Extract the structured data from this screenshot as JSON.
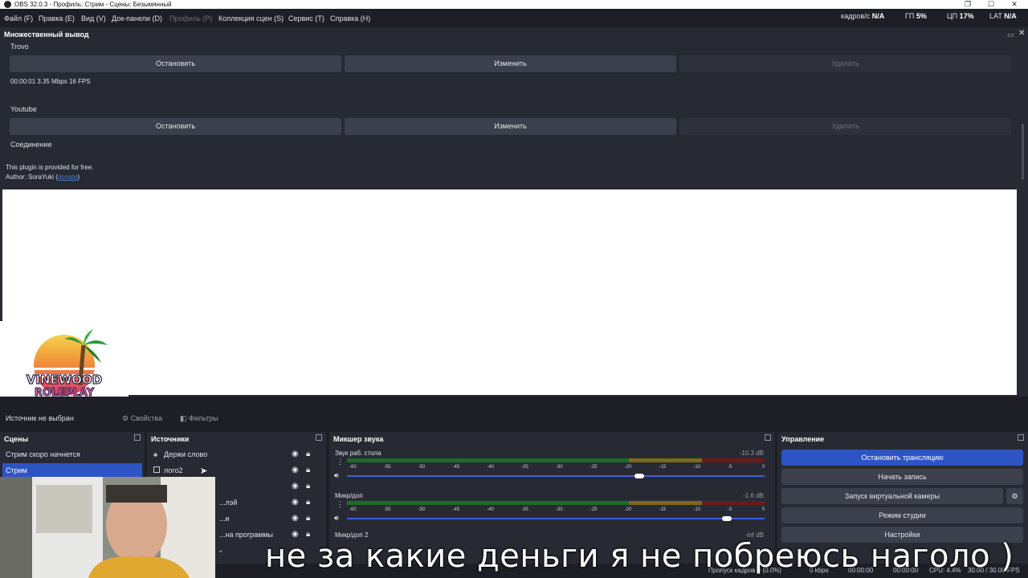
{
  "titlebar": {
    "title": "OBS 32.0.3 - Профиль: Стрим - Сцены: Безымянный"
  },
  "menu": {
    "items": [
      "Файл (F)",
      "Правка (E)",
      "Вид (V)",
      "Док-панели (D)",
      "Профиль (P)",
      "Коллекция сцен (S)",
      "Сервис (T)",
      "Справка (H)"
    ],
    "stats": {
      "fps_label": "кадров/с",
      "fps_value": "N/A",
      "gpu_label": "ГП",
      "gpu_value": "5%",
      "cpu_label": "ЦП",
      "cpu_value": "17%",
      "lat_label": "LAT",
      "lat_value": "N/A"
    }
  },
  "multi_output": {
    "title": "Множественный вывод",
    "targets": [
      {
        "name": "Trovo",
        "stop": "Остановить",
        "edit": "Изменить",
        "delete": "Удалить",
        "status": "00:00:01  3.35 Mbps  16 FPS"
      },
      {
        "name": "Youtube",
        "stop": "Остановить",
        "edit": "Изменить",
        "delete": "Удалить",
        "status": "Соединение"
      }
    ],
    "footer_line1": "This plugin is provided for free.",
    "footer_author": "Author: SoraYuki (",
    "footer_donate": "donate",
    "footer_close": ")"
  },
  "context": {
    "no_source": "Источник не выбран",
    "properties": "Свойства",
    "filters": "Фильтры"
  },
  "scenes": {
    "title": "Сцены",
    "items": [
      "Стрим скоро начнется",
      "Стрим"
    ],
    "selected": 1
  },
  "sources": {
    "title": "Источники",
    "items": [
      "Держи слово",
      "лого2",
      "",
      "...лэй",
      "...и",
      "...на программы"
    ]
  },
  "mixer": {
    "title": "Микшер звука",
    "channels": [
      {
        "name": "Звук раб. стола",
        "db": "-10.3 dB",
        "level": 0.7
      },
      {
        "name": "Микр/доп",
        "db": "-1.6 dB",
        "level": 0.91
      },
      {
        "name": "Микр/доп 2",
        "db": "-inf dB",
        "level": 0
      }
    ],
    "ticks": [
      "-60",
      "-55",
      "-50",
      "-45",
      "-40",
      "-35",
      "-30",
      "-25",
      "-20",
      "-15",
      "-10",
      "-5",
      "0"
    ]
  },
  "controls": {
    "title": "Управление",
    "stop_stream": "Остановить трансляцию",
    "start_record": "Начать запись",
    "virtual_cam": "Запуск виртуальной камеры",
    "studio_mode": "Режим студии",
    "settings": "Настройки"
  },
  "status": {
    "dropped": "Пропуск кадров 0 (0.0%)",
    "kbps": "0 kbps",
    "rec_time": "00:00:00",
    "stream_time": "00:00:00",
    "cpu": "CPU: 4.4%",
    "fps": "30.00 / 30.00 FPS"
  },
  "subtitle": "не за какие деньги я не побреюсь наголо )",
  "logo_text1": "VINEWOOD",
  "logo_text2": "ROLEPLAY"
}
